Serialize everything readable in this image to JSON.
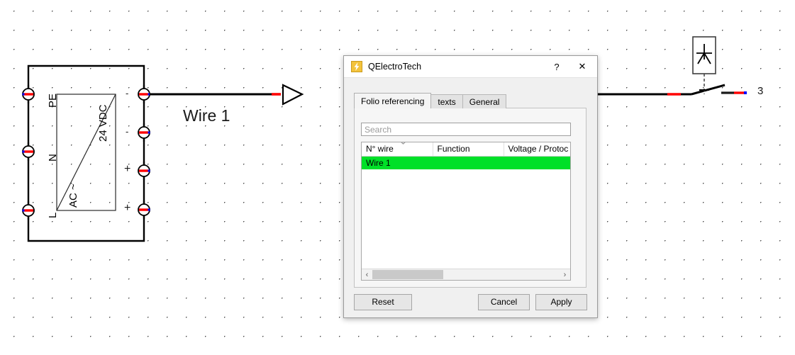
{
  "canvas": {
    "grid": "dot-grid",
    "wire_label": "Wire 1",
    "terminal_label_3": "3",
    "power_supply": {
      "left_terminals": [
        "PE",
        "N",
        "L"
      ],
      "right_terminals": [
        "-",
        "-",
        "+",
        "+"
      ],
      "inner_label_ac": "AC ~",
      "inner_label_dc": "24 VDC"
    }
  },
  "dialog": {
    "title": "QElectroTech",
    "icon": "lightning-bolt-icon",
    "help_label": "?",
    "close_label": "✕",
    "tabs": [
      {
        "label": "Folio referencing",
        "active": true
      },
      {
        "label": "texts",
        "active": false
      },
      {
        "label": "General",
        "active": false
      }
    ],
    "search": {
      "placeholder": "Search",
      "value": ""
    },
    "table": {
      "columns": [
        "N° wire",
        "Function",
        "Voltage / Protoc"
      ],
      "sort_column": "N° wire",
      "sort_direction": "descending",
      "rows": [
        {
          "wire": "Wire 1",
          "function": "",
          "voltage": "",
          "selected": true
        }
      ],
      "selection_color": "#00e028"
    },
    "scrollbar": {
      "left_arrow": "‹",
      "right_arrow": "›"
    },
    "buttons": {
      "reset": "Reset",
      "cancel": "Cancel",
      "apply": "Apply"
    }
  }
}
